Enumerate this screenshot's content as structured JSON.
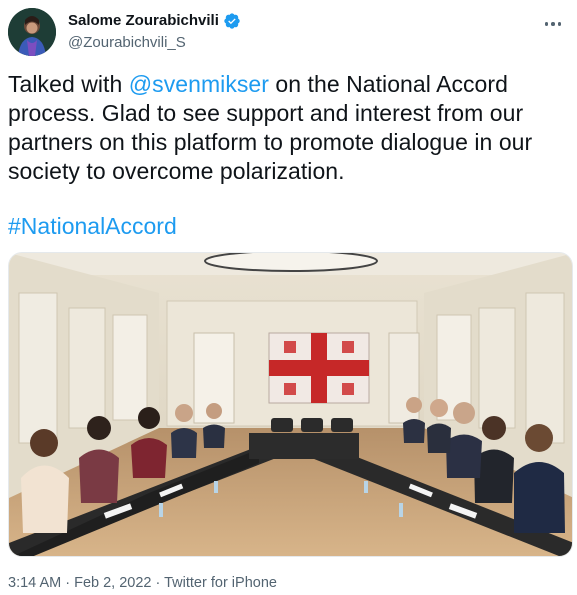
{
  "author": {
    "display_name": "Salome Zourabichvili",
    "handle": "@Zourabichvili_S",
    "verified": true
  },
  "icons": {
    "verified": "verified-badge-icon",
    "more": "more-options-icon"
  },
  "tweet": {
    "lines": [
      {
        "before": "Talked with ",
        "mention": "@svenmikser",
        "after": " on the National Accord"
      },
      {
        "text": "process. Glad to see support and interest from our"
      },
      {
        "text": "partners on this platform to promote dialogue in our"
      },
      {
        "text": "society to overcome polarization."
      }
    ],
    "hashtag": "#NationalAccord"
  },
  "meta": {
    "time": "3:14 AM",
    "separator1": " · ",
    "date": "Feb 2, 2022",
    "separator2": " · ",
    "source": "Twitter for iPhone"
  },
  "colors": {
    "link": "#1d9bf0",
    "text": "#0f1419",
    "secondary": "#536471",
    "verified": "#1d9bf0"
  }
}
